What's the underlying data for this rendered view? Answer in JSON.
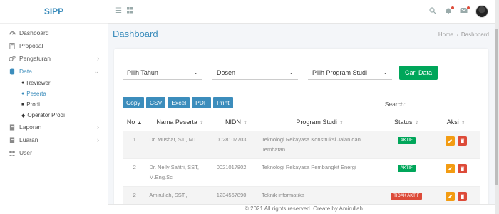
{
  "brand": "SIPP",
  "sidebar": {
    "items": [
      {
        "label": "Dashboard",
        "icon": "dashboard-icon"
      },
      {
        "label": "Proposal",
        "icon": "document-icon"
      },
      {
        "label": "Pengaturan",
        "icon": "cogs-icon"
      },
      {
        "label": "Data",
        "icon": "database-icon"
      },
      {
        "label": "Laporan",
        "icon": "report-icon"
      },
      {
        "label": "Luaran",
        "icon": "file-icon"
      },
      {
        "label": "User",
        "icon": "users-icon"
      }
    ],
    "data_sub": [
      {
        "label": "Reviewer"
      },
      {
        "label": "Peserta"
      },
      {
        "label": "Prodi"
      },
      {
        "label": "Operator Prodi"
      }
    ]
  },
  "header": {
    "page_title": "Dashboard",
    "breadcrumb_home": "Home",
    "breadcrumb_current": "Dashboard"
  },
  "filters": {
    "tahun": "Pilih Tahun",
    "dosen": "Dosen",
    "prodi": "Pilih Program Studi",
    "cari_label": "Cari Data"
  },
  "export_buttons": [
    "Copy",
    "CSV",
    "Excel",
    "PDF",
    "Print"
  ],
  "search": {
    "label": "Search:",
    "value": ""
  },
  "table": {
    "headers": [
      "No",
      "Nama Peserta",
      "NIDN",
      "Program Studi",
      "Status",
      "Aksi"
    ],
    "rows": [
      {
        "no": "1",
        "nama": "Dr. Musbar, ST., MT",
        "nidn": "0028107703",
        "prodi": "Teknologi Rekayasa Konstruksi Jalan dan Jembatan",
        "status": "AKTIF"
      },
      {
        "no": "2",
        "nama": "Dr. Nelly Safitri, SST, M.Eng.Sc",
        "nidn": "0021017802",
        "prodi": "Teknologi Rekayasa Pembangkit Energi",
        "status": "AKTIF"
      },
      {
        "no": "2",
        "nama": "Amirullah, SST.,",
        "nidn": "1234567890",
        "prodi": "Teknik informatika",
        "status": "TIDAK AKTIF"
      }
    ]
  },
  "footer": "© 2021 All rights reserved. Create by Amirullah",
  "colors": {
    "primary": "#3c8dbc",
    "success": "#00a65a",
    "danger": "#dd4b39",
    "warning": "#f39c12"
  }
}
